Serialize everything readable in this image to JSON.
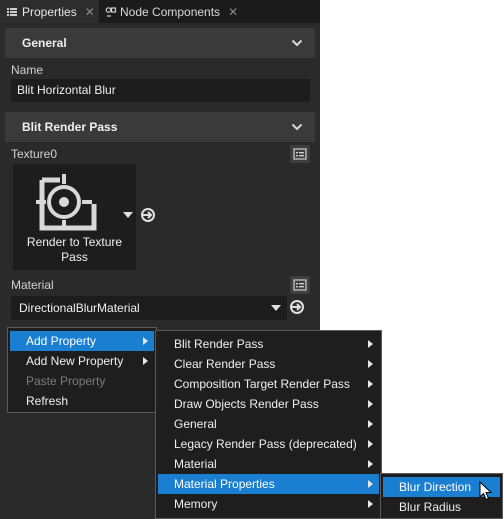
{
  "tabs": {
    "properties_label": "Properties",
    "node_components_label": "Node Components"
  },
  "general": {
    "header": "General",
    "name_label": "Name",
    "name_value": "Blit Horizontal Blur"
  },
  "blit_render_pass": {
    "header": "Blit Render Pass",
    "texture_label": "Texture0",
    "texture_caption": "Render to Texture Pass",
    "material_label": "Material",
    "material_value": "DirectionalBlurMaterial"
  },
  "context_menu": {
    "items": [
      {
        "label": "Add Property",
        "submenu": true,
        "highlighted": true,
        "enabled": true
      },
      {
        "label": "Add New Property",
        "submenu": true,
        "highlighted": false,
        "enabled": true
      },
      {
        "label": "Paste Property",
        "submenu": false,
        "highlighted": false,
        "enabled": false
      },
      {
        "label": "Refresh",
        "submenu": false,
        "highlighted": false,
        "enabled": true
      }
    ]
  },
  "add_property_menu": {
    "items": [
      {
        "label": "Blit Render Pass",
        "submenu": true
      },
      {
        "label": "Clear Render Pass",
        "submenu": true
      },
      {
        "label": "Composition Target Render Pass",
        "submenu": true
      },
      {
        "label": "Draw Objects Render Pass",
        "submenu": true
      },
      {
        "label": "General",
        "submenu": true
      },
      {
        "label": "Legacy Render Pass (deprecated)",
        "submenu": true
      },
      {
        "label": "Material",
        "submenu": true
      },
      {
        "label": "Material Properties",
        "submenu": true,
        "highlighted": true
      },
      {
        "label": "Memory",
        "submenu": true
      }
    ]
  },
  "material_properties_menu": {
    "items": [
      {
        "label": "Blur Direction",
        "highlighted": true
      },
      {
        "label": "Blur Radius",
        "highlighted": false
      }
    ]
  },
  "colors": {
    "panel_bg": "#2a2a2a",
    "header_bg": "#3a3a3a",
    "field_bg": "#1c1c1c",
    "highlight": "#1a7fd0"
  }
}
